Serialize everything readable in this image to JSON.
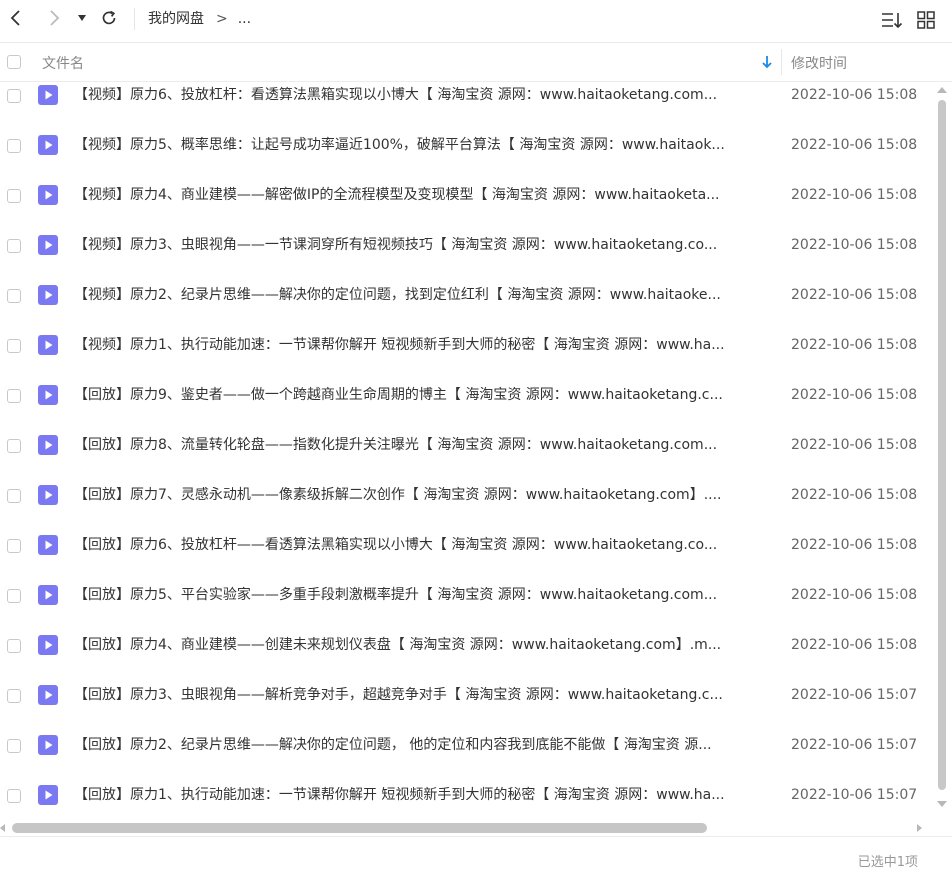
{
  "breadcrumb": {
    "root": "我的网盘",
    "separator": ">",
    "more": "..."
  },
  "toolbar": {
    "back_icon": "chevron-left-icon",
    "forward_icon": "chevron-right-icon",
    "dropdown_icon": "caret-down-icon",
    "refresh_icon": "refresh-icon",
    "sort_icon": "sort-list-icon",
    "grid_icon": "grid-view-icon"
  },
  "header": {
    "name": "文件名",
    "time": "修改时间",
    "sort_icon": "sort-down-arrow-icon"
  },
  "colors": {
    "accent": "#1e88e5",
    "file_icon": "#7b79f2"
  },
  "files": [
    {
      "name": "【视频】原力6、投放杠杆：看透算法黑箱实现以小博大【 海淘宝资 源网：www.haitaoketang.com...",
      "time": "2022-10-06 15:08"
    },
    {
      "name": "【视频】原力5、概率思维：让起号成功率逼近100%，破解平台算法【 海淘宝资 源网：www.haitaok...",
      "time": "2022-10-06 15:08"
    },
    {
      "name": "【视频】原力4、商业建模——解密做IP的全流程模型及变现模型【 海淘宝资 源网：www.haitaoketa...",
      "time": "2022-10-06 15:08"
    },
    {
      "name": "【视频】原力3、虫眼视角——一节课洞穿所有短视频技巧【 海淘宝资 源网：www.haitaoketang.co...",
      "time": "2022-10-06 15:08"
    },
    {
      "name": "【视频】原力2、纪录片思维——解决你的定位问题，找到定位红利【 海淘宝资 源网：www.haitaoke...",
      "time": "2022-10-06 15:08"
    },
    {
      "name": "【视频】原力1、执行动能加速：一节课帮你解开 短视频新手到大师的秘密【 海淘宝资 源网：www.ha...",
      "time": "2022-10-06 15:08"
    },
    {
      "name": "【回放】原力9、鉴史者——做一个跨越商业生命周期的博主【 海淘宝资 源网：www.haitaoketang.c...",
      "time": "2022-10-06 15:08"
    },
    {
      "name": "【回放】原力8、流量转化轮盘——指数化提升关注曝光【 海淘宝资 源网：www.haitaoketang.com...",
      "time": "2022-10-06 15:08"
    },
    {
      "name": "【回放】原力7、灵感永动机——像素级拆解二次创作【 海淘宝资 源网：www.haitaoketang.com】....",
      "time": "2022-10-06 15:08"
    },
    {
      "name": "【回放】原力6、投放杠杆——看透算法黑箱实现以小博大【 海淘宝资 源网：www.haitaoketang.co...",
      "time": "2022-10-06 15:08"
    },
    {
      "name": "【回放】原力5、平台实验家——多重手段刺激概率提升【 海淘宝资 源网：www.haitaoketang.com...",
      "time": "2022-10-06 15:08"
    },
    {
      "name": "【回放】原力4、商业建模——创建未来规划仪表盘【 海淘宝资 源网：www.haitaoketang.com】.m...",
      "time": "2022-10-06 15:08"
    },
    {
      "name": "【回放】原力3、虫眼视角——解析竞争对手，超越竞争对手【 海淘宝资 源网：www.haitaoketang.c...",
      "time": "2022-10-06 15:07"
    },
    {
      "name": "【回放】原力2、纪录片思维——解决你的定位问题， 他的定位和内容我到底能不能做【 海淘宝资 源...",
      "time": "2022-10-06 15:07"
    },
    {
      "name": "【回放】原力1、执行动能加速：一节课帮你解开 短视频新手到大师的秘密【 海淘宝资 源网：www.ha...",
      "time": "2022-10-06 15:07"
    }
  ],
  "status": {
    "selected": "已选中1项"
  }
}
